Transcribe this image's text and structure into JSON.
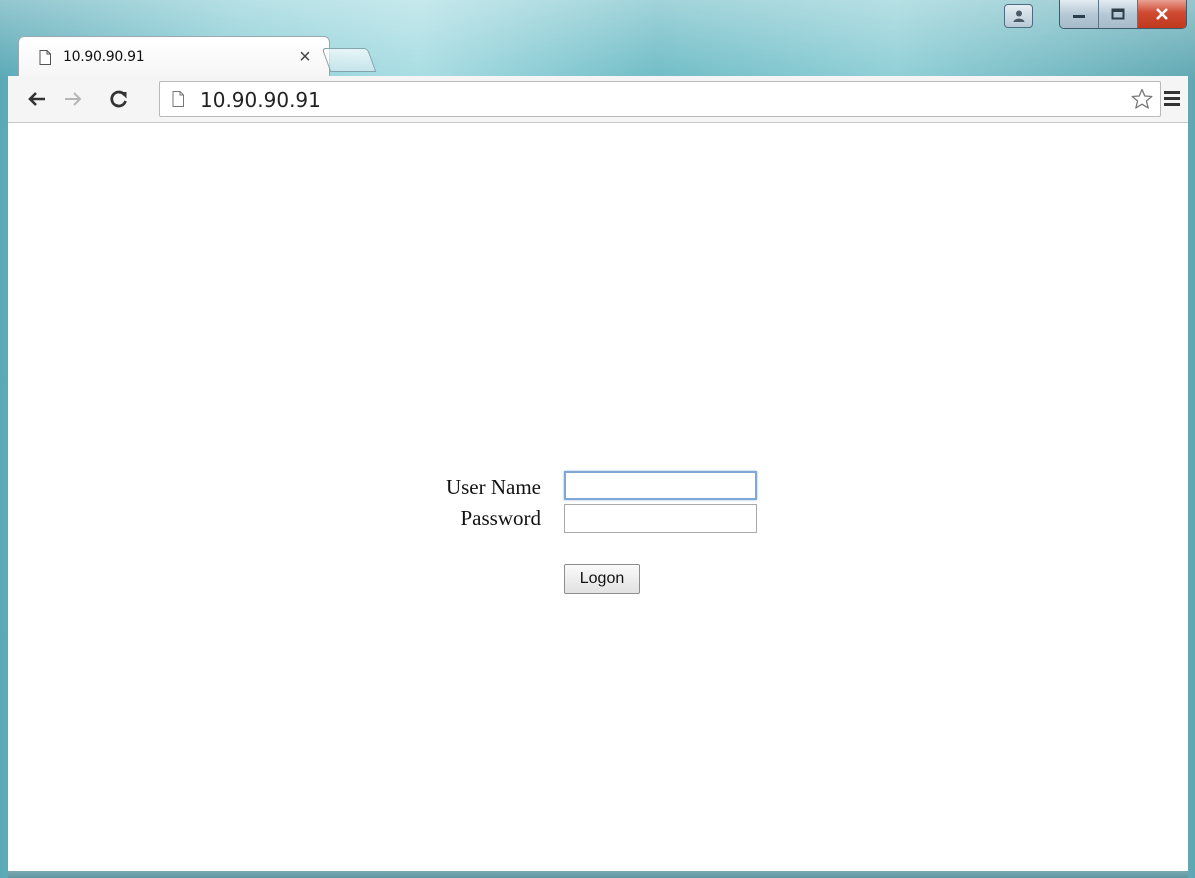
{
  "tab": {
    "title": "10.90.90.91",
    "close_symbol": "×"
  },
  "address_bar": {
    "url": "10.90.90.91"
  },
  "login": {
    "username_label": "User Name",
    "password_label": "Password",
    "username_value": "",
    "password_value": "",
    "logon_label": "Logon"
  },
  "icons": {
    "back": "back-arrow-icon",
    "forward": "forward-arrow-icon",
    "reload": "reload-icon",
    "page": "page-icon",
    "bookmark": "star-icon",
    "menu": "menu-icon",
    "user": "user-icon",
    "minimize": "minimize-icon",
    "maximize": "maximize-icon",
    "close": "close-icon"
  }
}
